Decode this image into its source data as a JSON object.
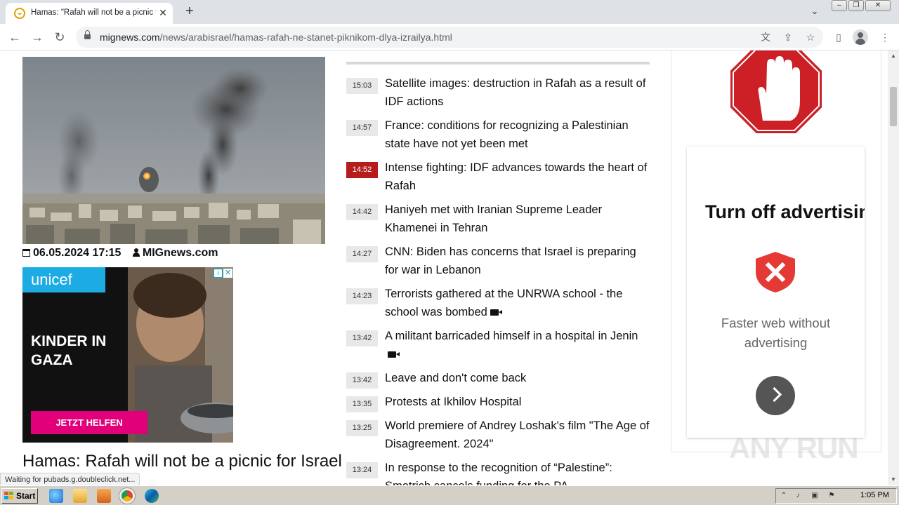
{
  "browser": {
    "tab_title": "Hamas: \"Rafah will not be a picnic fo",
    "url_domain": "mignews.com",
    "url_path": "/news/arabisrael/hamas-rafah-ne-stanet-piknikom-dlya-izrailya.html",
    "status_text": "Waiting for pubads.g.doubleclick.net..."
  },
  "article": {
    "date": "06.05.2024 17:15",
    "author": "MIGnews.com",
    "title": "Hamas: Rafah will not be a picnic for Israel"
  },
  "ad": {
    "brand": "unicef",
    "headline": "KINDER IN GAZA",
    "cta": "JETZT HELFEN",
    "info_icon": "i",
    "close_icon": "✕"
  },
  "news": [
    {
      "time": "15:03",
      "text": "Satellite images: destruction in Rafah as a result of IDF actions",
      "hot": false,
      "video": false
    },
    {
      "time": "14:57",
      "text": "France: conditions for recognizing a Palestinian state have not yet been met",
      "hot": false,
      "video": false
    },
    {
      "time": "14:52",
      "text": "Intense fighting: IDF advances towards the heart of Rafah",
      "hot": true,
      "video": false
    },
    {
      "time": "14:42",
      "text": "Haniyeh met with Iranian Supreme Leader Khamenei in Tehran",
      "hot": false,
      "video": false
    },
    {
      "time": "14:27",
      "text": "CNN: Biden has concerns that Israel is preparing for war in Lebanon",
      "hot": false,
      "video": false
    },
    {
      "time": "14:23",
      "text": "Terrorists gathered at the UNRWA school - the school was bombed",
      "hot": false,
      "video": true
    },
    {
      "time": "13:42",
      "text": "A militant barricaded himself in a hospital in Jenin",
      "hot": false,
      "video": true
    },
    {
      "time": "13:42",
      "text": "Leave and don't come back",
      "hot": false,
      "video": false
    },
    {
      "time": "13:35",
      "text": "Protests at Ikhilov Hospital",
      "hot": false,
      "video": false
    },
    {
      "time": "13:25",
      "text": "World premiere of Andrey Loshak's film \"The Age of Disagreement. 2024\"",
      "hot": false,
      "video": false
    },
    {
      "time": "13:24",
      "text": "In response to the recognition of “Palestine”: Smotrich cancels funding for the PA",
      "hot": false,
      "video": false
    }
  ],
  "adblock": {
    "title": "Turn off advertisin",
    "subtitle_line1": "Faster web without",
    "subtitle_line2": "advertising"
  },
  "watermark": "ANY RUN",
  "taskbar": {
    "start_label": "Start",
    "clock": "1:05 PM"
  },
  "colors": {
    "hot_time_bg": "#b71c1c",
    "stop_sign": "#cc1f26",
    "unicef_blue": "#1cabe2",
    "cta_pink": "#e2007a"
  }
}
